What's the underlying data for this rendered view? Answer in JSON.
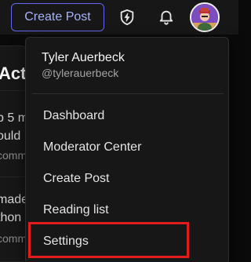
{
  "header": {
    "create_post_label": "Create Post",
    "icons": [
      "lightning-icon",
      "bell-icon"
    ]
  },
  "feed": {
    "heading": "Active",
    "posts": [
      {
        "line1": "p 5 m",
        "line2": "ould",
        "meta": "comm"
      },
      {
        "line1": "made",
        "line2": "thon",
        "meta": "comm"
      }
    ]
  },
  "user_menu": {
    "name": "Tyler Auerbeck",
    "handle": "@tylerauerbeck",
    "items": [
      {
        "label": "Dashboard"
      },
      {
        "label": "Moderator Center"
      },
      {
        "label": "Create Post"
      },
      {
        "label": "Reading list"
      },
      {
        "label": "Settings"
      }
    ]
  },
  "colors": {
    "accent": "#6366f1",
    "highlight": "#e11d1d",
    "menu_bg": "#171717"
  }
}
